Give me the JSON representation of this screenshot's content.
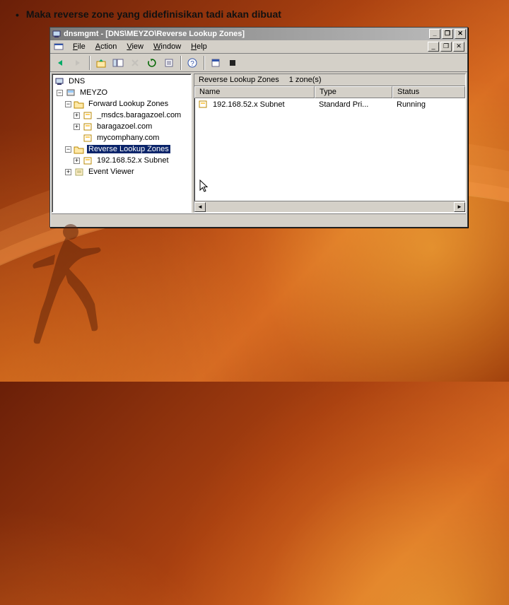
{
  "slide": {
    "bullet_text": "Maka reverse zone yang didefinisikan tadi akan dibuat"
  },
  "window": {
    "title": "dnsmgmt - [DNS\\MEYZO\\Reverse Lookup Zones]",
    "controls": {
      "min": "_",
      "max": "❐",
      "close": "✕"
    }
  },
  "menu": {
    "items": [
      "File",
      "Action",
      "View",
      "Window",
      "Help"
    ]
  },
  "toolbar": {
    "buttons": [
      {
        "name": "back-icon",
        "glyph": "←",
        "disabled": false
      },
      {
        "name": "forward-icon",
        "glyph": "→",
        "disabled": true
      },
      {
        "name": "up-icon",
        "glyph": "folder-up",
        "disabled": false
      },
      {
        "name": "show-hide-tree-icon",
        "glyph": "tree",
        "disabled": false
      },
      {
        "name": "delete-icon",
        "glyph": "✕",
        "disabled": true
      },
      {
        "name": "refresh-icon",
        "glyph": "refresh",
        "disabled": false
      },
      {
        "name": "export-list-icon",
        "glyph": "export",
        "disabled": false
      },
      {
        "name": "help-icon",
        "glyph": "?",
        "disabled": false
      },
      {
        "name": "properties-icon",
        "glyph": "props",
        "disabled": false
      },
      {
        "name": "stop-dns-icon",
        "glyph": "stop",
        "disabled": false
      }
    ]
  },
  "tree": {
    "root": "DNS",
    "server": "MEYZO",
    "forward_label": "Forward Lookup Zones",
    "forward_children": [
      "_msdcs.baragazoel.com",
      "baragazoel.com",
      "mycomphany.com"
    ],
    "reverse_label": "Reverse Lookup Zones",
    "reverse_children": [
      "192.168.52.x Subnet"
    ],
    "event_viewer": "Event Viewer"
  },
  "list": {
    "header_title": "Reverse Lookup Zones",
    "header_count": "1 zone(s)",
    "columns": {
      "name": "Name",
      "type": "Type",
      "status": "Status"
    },
    "rows": [
      {
        "name": "192.168.52.x Subnet",
        "type": "Standard Pri...",
        "status": "Running"
      }
    ]
  }
}
